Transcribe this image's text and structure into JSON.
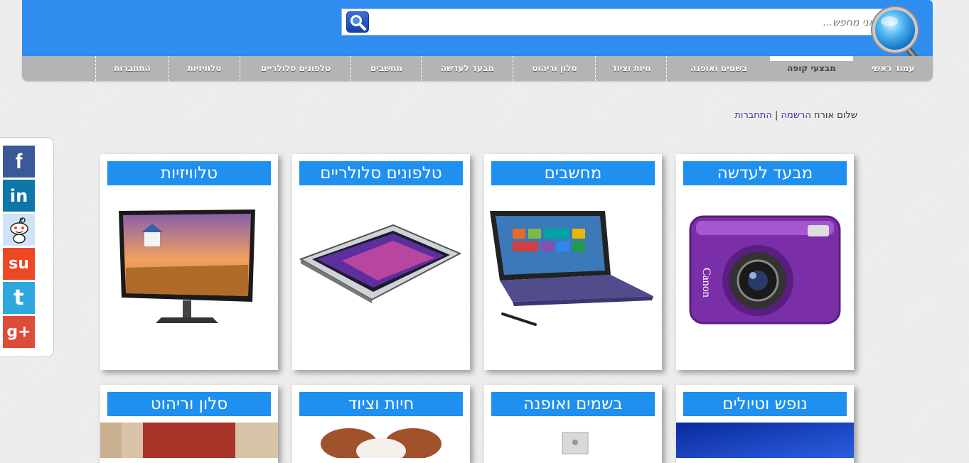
{
  "search": {
    "placeholder": "אני מחפש..."
  },
  "nav": {
    "items": [
      "עמוד ראשי",
      "מבצעי קופה",
      "בשמים ואופנה",
      "חיות וציוד",
      "סלון וריהוט",
      "מבעד לעדשה",
      "מחשבים",
      "טלפונים סלולריים",
      "טלוויזיות",
      "התחברות"
    ],
    "active_index": 1
  },
  "greeting": {
    "text": "שלום אורח",
    "register": "הרשמה",
    "separator": "|",
    "login": "התחברות"
  },
  "social": {
    "items": [
      "facebook",
      "linkedin",
      "reddit",
      "stumbleupon",
      "twitter",
      "google-plus"
    ],
    "labels": {
      "facebook": "f",
      "linkedin": "in",
      "stumbleupon": "su",
      "twitter": "t",
      "google_plus": "g+"
    }
  },
  "categories": [
    {
      "title": "מבעד לעדשה",
      "image": "camera"
    },
    {
      "title": "מחשבים",
      "image": "tablet-laptop"
    },
    {
      "title": "טלפונים סלולריים",
      "image": "tablet-phone"
    },
    {
      "title": "טלוויזיות",
      "image": "tv-monitor"
    },
    {
      "title": "נופש וטיולים",
      "image": "sky"
    },
    {
      "title": "בשמים ואופנה",
      "image": "perfume"
    },
    {
      "title": "חיות וציוד",
      "image": "dog"
    },
    {
      "title": "סלון וריהוט",
      "image": "furniture"
    }
  ],
  "colors": {
    "header": "#2f8df0",
    "nav": "#b4b4b4",
    "card_title": "#1f8ff0",
    "facebook": "#3b5998",
    "linkedin": "#0e76a8",
    "reddit": "#cee3f8",
    "stumbleupon": "#eb4924",
    "twitter": "#2fa8e0",
    "google_plus": "#dd4b39"
  }
}
